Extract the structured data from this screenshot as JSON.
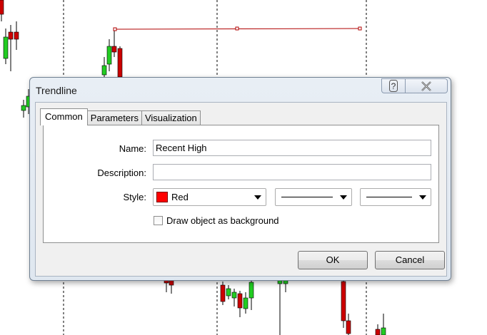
{
  "dialog": {
    "title": "Trendline",
    "help_label": "?",
    "close_label": "✕"
  },
  "tabs": [
    {
      "label": "Common",
      "active": true
    },
    {
      "label": "Parameters",
      "active": false
    },
    {
      "label": "Visualization",
      "active": false
    }
  ],
  "form": {
    "name_label": "Name:",
    "name_value": "Recent High",
    "description_label": "Description:",
    "description_value": "",
    "style_label": "Style:",
    "color_value": "Red",
    "color_hex": "#ff0000",
    "line_style_icon": "solid-line",
    "line_width_icon": "thin-line",
    "background_checkbox_label": "Draw object as background",
    "background_checked": false
  },
  "buttons": {
    "ok": "OK",
    "cancel": "Cancel"
  },
  "chart": {
    "bull_color": "#22cc22",
    "bear_color": "#cc0000",
    "trendline_color": "#b00000"
  }
}
